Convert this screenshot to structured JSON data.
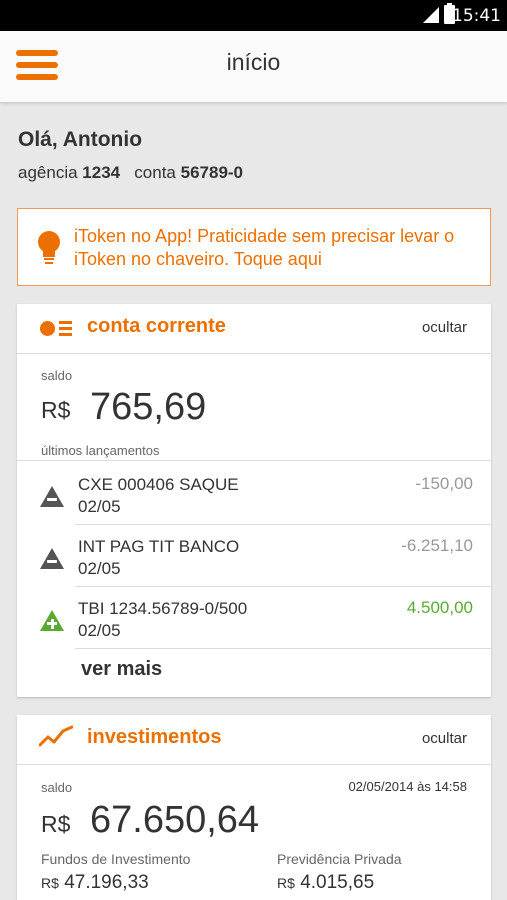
{
  "status": {
    "time": "15:41"
  },
  "header": {
    "title": "início",
    "menu_icon": "hamburger-menu-icon"
  },
  "greeting": {
    "text": "Olá, Antonio"
  },
  "account": {
    "agency_label": "agência",
    "agency": "1234",
    "account_label": "conta",
    "account": "56789-0"
  },
  "banner": {
    "icon": "lightbulb-icon",
    "text": "iToken no App! Praticidade sem precisar levar o iToken no chaveiro. Toque aqui"
  },
  "checking": {
    "title": "conta corrente",
    "hide_label": "ocultar",
    "balance_label": "saldo",
    "currency": "R$",
    "balance": "765,69",
    "recent_label": "últimos lançamentos",
    "transactions": [
      {
        "line1": "CXE 000406 SAQUE",
        "date": "02/05",
        "amount": "-150,00",
        "type": "debit"
      },
      {
        "line1": "INT PAG TIT BANCO",
        "date": "02/05",
        "amount": "-6.251,10",
        "type": "debit"
      },
      {
        "line1": "TBI 1234.56789-0/500",
        "date": "02/05",
        "amount": "4.500,00",
        "type": "credit"
      }
    ],
    "more_label": "ver mais"
  },
  "investments": {
    "title": "investimentos",
    "hide_label": "ocultar",
    "balance_label": "saldo",
    "timestamp": "02/05/2014 às 14:58",
    "currency": "R$",
    "balance": "67.650,64",
    "funds": {
      "label": "Fundos de Investimento",
      "currency": "R$",
      "value": "47.196,33"
    },
    "pension": {
      "label": "Previdência Privada",
      "currency": "R$",
      "value": "4.015,65"
    }
  },
  "colors": {
    "accent": "#ec7000",
    "positive": "#5aa932",
    "negative": "#999999"
  }
}
